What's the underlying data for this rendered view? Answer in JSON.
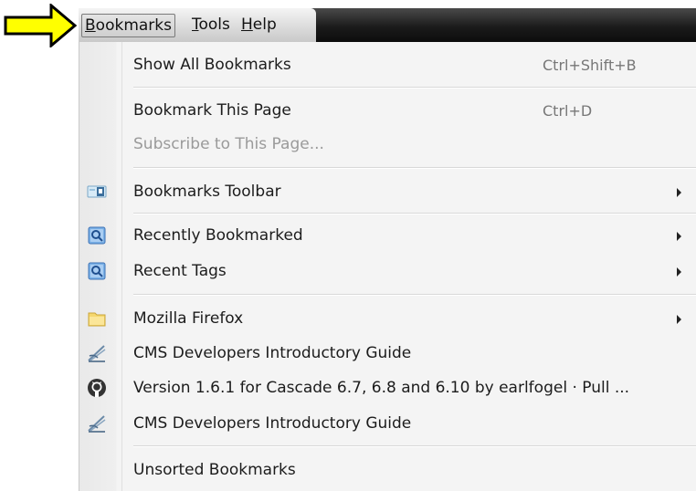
{
  "menubar": {
    "items": [
      {
        "label": "Bookmarks",
        "active": true
      },
      {
        "label": "Tools"
      },
      {
        "label": "Help"
      }
    ]
  },
  "dropdown": {
    "items": [
      {
        "label": "Show All Bookmarks",
        "shortcut": "Ctrl+Shift+B"
      },
      {
        "label": "Bookmark This Page",
        "shortcut": "Ctrl+D"
      },
      {
        "label": "Subscribe to This Page...",
        "disabled": true
      },
      {
        "label": "Bookmarks Toolbar",
        "icon": "bookmarks-toolbar-icon",
        "submenu": true
      },
      {
        "label": "Recently Bookmarked",
        "icon": "smart-folder-icon",
        "submenu": true
      },
      {
        "label": "Recent Tags",
        "icon": "smart-folder-icon",
        "submenu": true
      },
      {
        "label": "Mozilla Firefox",
        "icon": "folder-icon",
        "submenu": true
      },
      {
        "label": "CMS Developers Introductory Guide",
        "icon": "pen-logo-icon"
      },
      {
        "label": "Version 1.6.1 for Cascade 6.7, 6.8 and 6.10 by earlfogel · Pull ...",
        "icon": "github-icon"
      },
      {
        "label": "CMS Developers Introductory Guide",
        "icon": "pen-logo-icon"
      },
      {
        "label": "Unsorted Bookmarks"
      }
    ]
  },
  "colors": {
    "arrow_fill": "#ffff00",
    "menubar_dark": "#151515",
    "menu_bg": "#f4f4f4"
  }
}
